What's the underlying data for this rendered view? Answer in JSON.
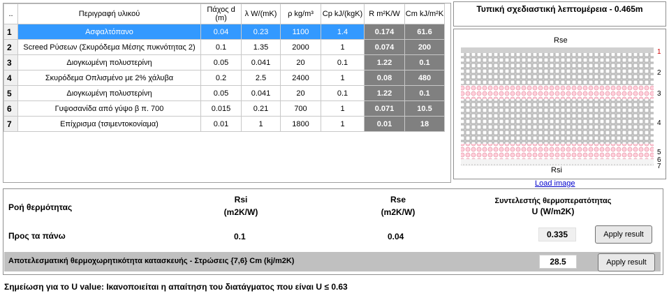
{
  "table": {
    "headers": {
      "num": "..",
      "desc": "Περιγραφή υλικού",
      "thickness": "Πάχος d (m)",
      "lambda": "λ W/(mK)",
      "rho": "ρ kg/m³",
      "cp": "Cp kJ/(kgK)",
      "r": "R m²K/W",
      "cm": "Cm kJ/m²K"
    },
    "rows": [
      {
        "num": "1",
        "desc": "Ασφαλτόπανο",
        "d": "0.04",
        "lambda": "0.23",
        "rho": "1100",
        "cp": "1.4",
        "r": "0.174",
        "cm": "61.6"
      },
      {
        "num": "2",
        "desc": "Screed Ρύσεων (Σκυρόδεμα Μέσης πυκνότητας 2)",
        "d": "0.1",
        "lambda": "1.35",
        "rho": "2000",
        "cp": "1",
        "r": "0.074",
        "cm": "200"
      },
      {
        "num": "3",
        "desc": "Διογκωμένη πολυστερίνη",
        "d": "0.05",
        "lambda": "0.041",
        "rho": "20",
        "cp": "0.1",
        "r": "1.22",
        "cm": "0.1"
      },
      {
        "num": "4",
        "desc": "Σκυρόδεμα Οπλισμένο με 2% χάλυβα",
        "d": "0.2",
        "lambda": "2.5",
        "rho": "2400",
        "cp": "1",
        "r": "0.08",
        "cm": "480"
      },
      {
        "num": "5",
        "desc": "Διογκωμένη πολυστερίνη",
        "d": "0.05",
        "lambda": "0.041",
        "rho": "20",
        "cp": "0.1",
        "r": "1.22",
        "cm": "0.1"
      },
      {
        "num": "6",
        "desc": "Γυψοσανίδα από γύψο β π. 700",
        "d": "0.015",
        "lambda": "0.21",
        "rho": "700",
        "cp": "1",
        "r": "0.071",
        "cm": "10.5"
      },
      {
        "num": "7",
        "desc": "Επίχρισμα (τσιμεντοκονίαμα)",
        "d": "0.01",
        "lambda": "1",
        "rho": "1800",
        "cp": "1",
        "r": "0.01",
        "cm": "18"
      }
    ]
  },
  "detail": {
    "title": "Τυπική σχεδιαστική λεπτομέρεια - 0.465m",
    "rse": "Rse",
    "rsi": "Rsi",
    "layer_numbers": [
      "1",
      "2",
      "3",
      "4",
      "5",
      "6",
      "7"
    ],
    "load_image": "Load image"
  },
  "panel": {
    "flow_label": "Ροή θερμότητας",
    "rsi_header": "Rsi\n(m2K/W)",
    "rsi_header_l1": "Rsi",
    "rsi_header_l2": "(m2K/W)",
    "rse_header_l1": "Rse",
    "rse_header_l2": "(m2K/W)",
    "u_header_l1": "Συντελεστής θερμοπερατότητας",
    "u_header_l2": "U (W/m2K)",
    "direction": "Προς τα πάνω",
    "rsi_value": "0.1",
    "rse_value": "0.04",
    "u_value": "0.335",
    "apply_label": "Apply result",
    "cm_label": "Αποτελεσματική θερμοχωρητικότητα κατασκευής - Στρώσεις {7,6} Cm (kj/m2K)",
    "cm_value": "28.5"
  },
  "note": "Σημείωση για το U value: Ικανοποιείται η απαίτηση του διατάγματος που είναι U ≤ 0.63"
}
